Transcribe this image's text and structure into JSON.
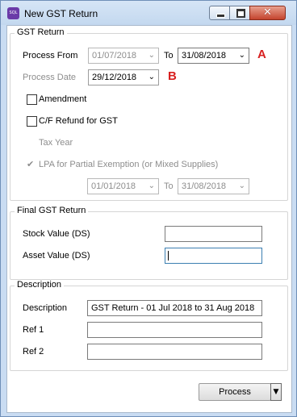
{
  "window": {
    "title": "New GST Return",
    "app_icon_text": "SQL"
  },
  "gst_return": {
    "group_title": "GST Return",
    "process_from_label": "Process From",
    "process_from_value": "01/07/2018",
    "to_label": "To",
    "process_to_value": "31/08/2018",
    "marker_a": "A",
    "process_date_label": "Process Date",
    "process_date_value": "29/12/2018",
    "marker_b": "B",
    "amendment_label": "Amendment",
    "cf_refund_label": "C/F Refund for GST",
    "tax_year_label": "Tax Year",
    "lpa_label": "LPA for Partial Exemption (or Mixed Supplies)",
    "lpa_from_value": "01/01/2018",
    "lpa_to_label": "To",
    "lpa_to_value": "31/08/2018"
  },
  "final_gst_return": {
    "group_title": "Final GST Return",
    "stock_value_label": "Stock Value (DS)",
    "stock_value": "",
    "asset_value_label": "Asset Value (DS)",
    "asset_value": ""
  },
  "description_section": {
    "group_title": "Description",
    "description_label": "Description",
    "description_value": "GST Return - 01 Jul 2018 to 31 Aug 2018",
    "ref1_label": "Ref 1",
    "ref1_value": "",
    "ref2_label": "Ref 2",
    "ref2_value": ""
  },
  "actions": {
    "process_label": "Process"
  },
  "icons": {
    "dropdown_arrow": "⌄",
    "checkmark": "✔",
    "close_glyph": "✕",
    "split_arrow": "▼"
  },
  "colors": {
    "marker": "#d82020",
    "close_button": "#c4442e",
    "titlebar": "#c9dcf2"
  }
}
